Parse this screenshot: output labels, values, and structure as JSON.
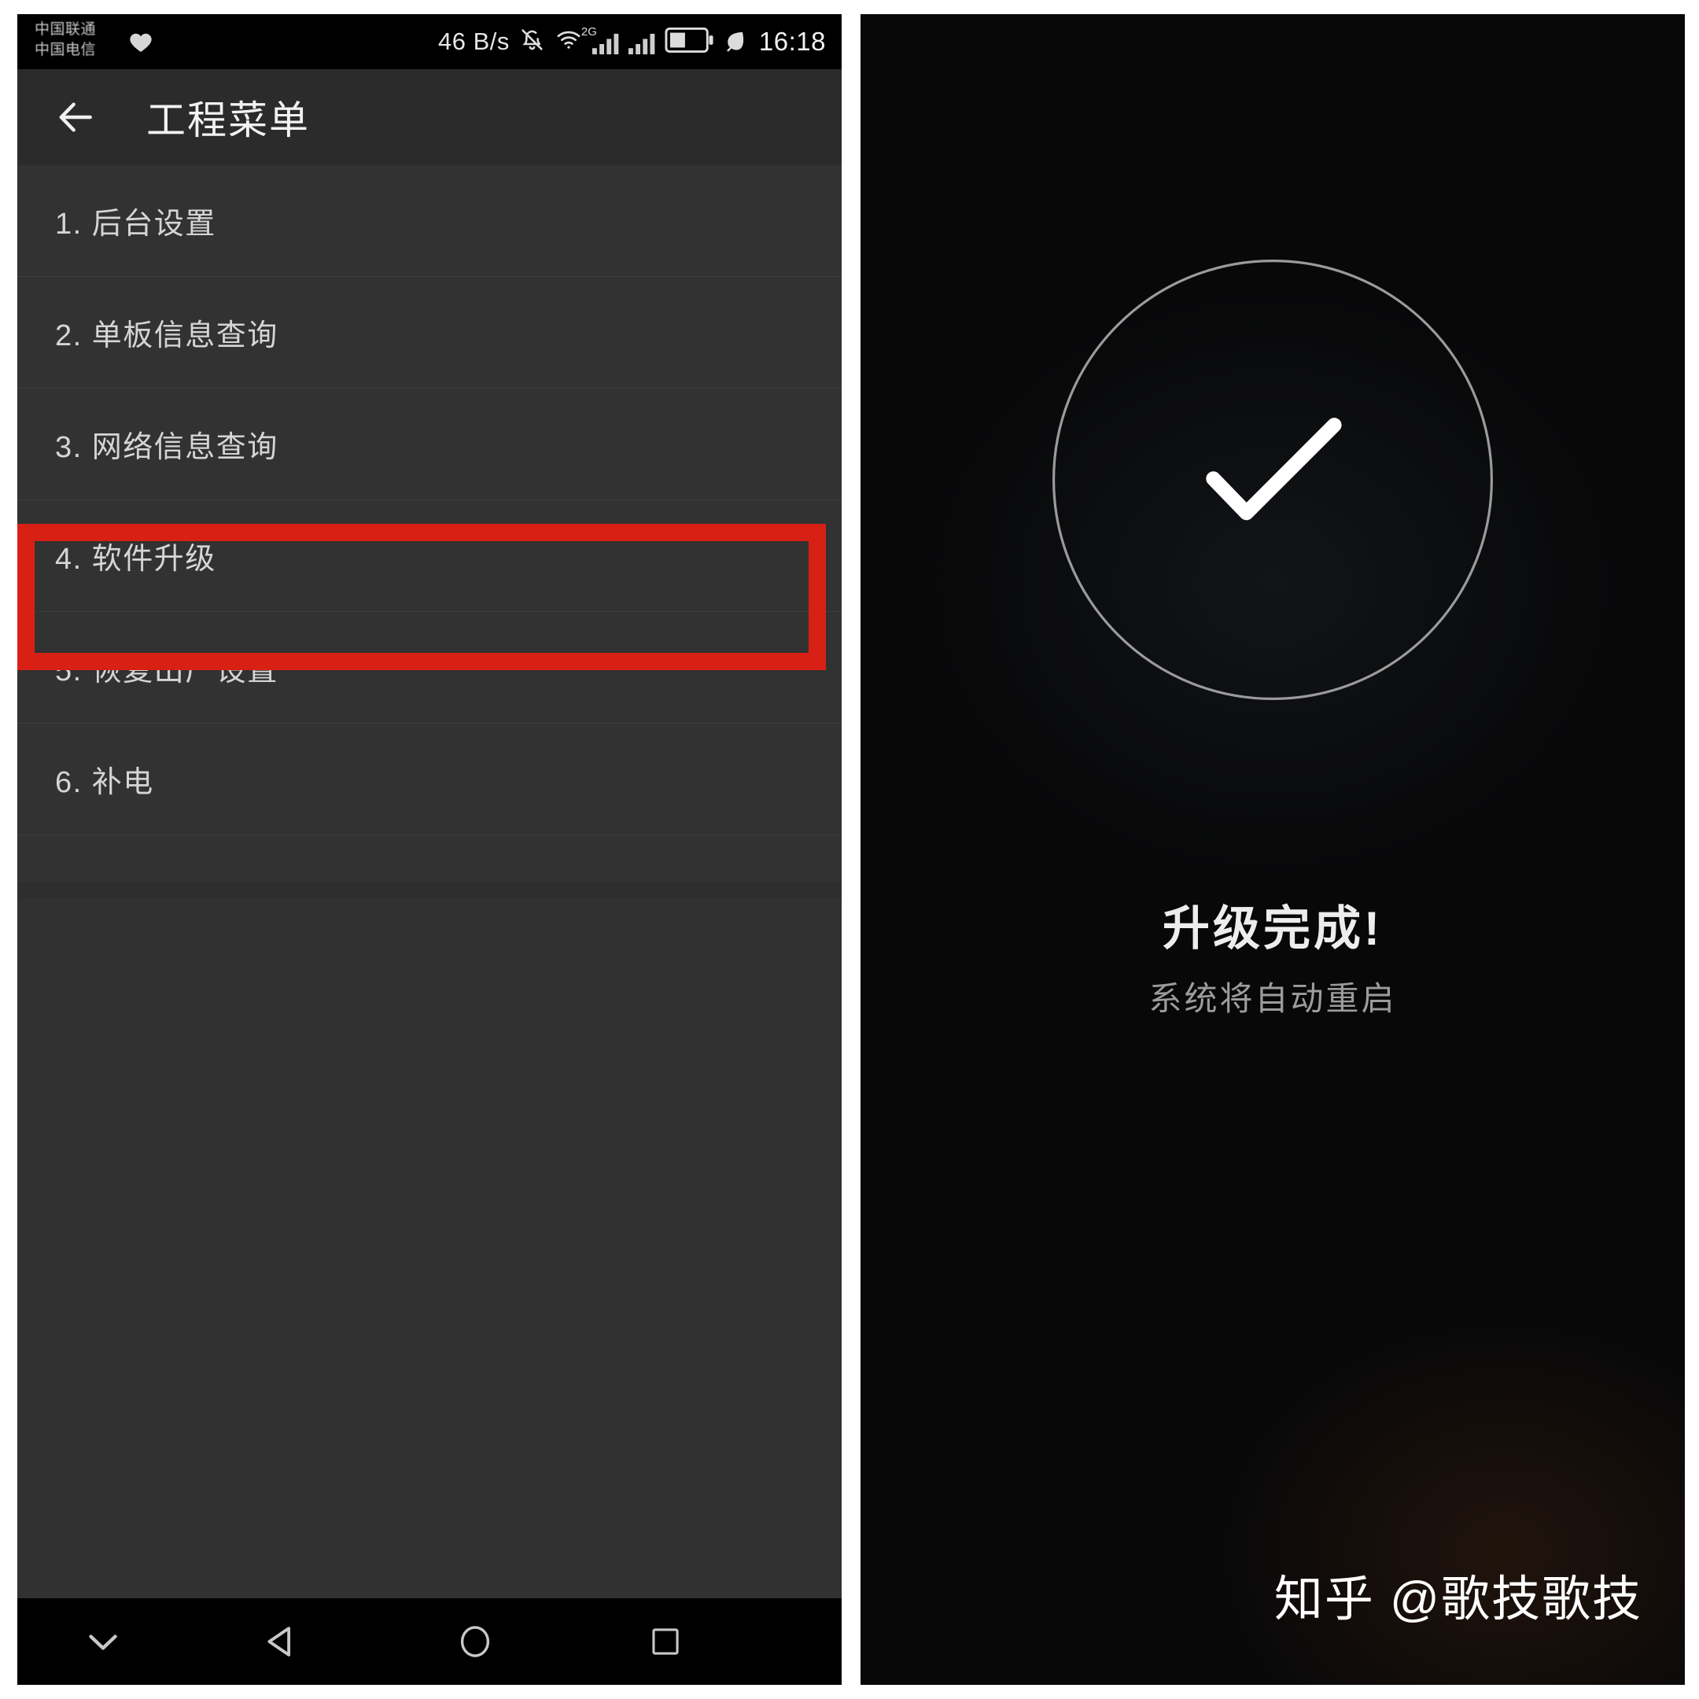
{
  "left_phone": {
    "status_bar": {
      "carrier_line1": "中国联通",
      "carrier_line2": "中国电信",
      "heart_icon": "heart-icon",
      "net_speed": "46 B/s",
      "mute_icon": "mute-bell-icon",
      "wifi_icon": "wifi-icon",
      "signal1_icon": "signal-bars-icon",
      "network_type_badge": "2G",
      "signal2_icon": "signal-bars-icon",
      "battery_icon": "battery-icon",
      "power_saver_icon": "leaf-icon",
      "clock": "16:18"
    },
    "app_bar": {
      "back_icon": "back-arrow-icon",
      "title": "工程菜单"
    },
    "menu_items": [
      {
        "label": "1. 后台设置"
      },
      {
        "label": "2. 单板信息查询"
      },
      {
        "label": "3. 网络信息查询"
      },
      {
        "label": "4. 软件升级"
      },
      {
        "label": "5. 恢复出厂设置"
      },
      {
        "label": "6. 补电"
      }
    ],
    "highlight": {
      "target_index": 3,
      "color": "#d92015"
    },
    "nav_bar": {
      "chevron_icon": "chevron-down-icon",
      "back_icon": "triangle-back-icon",
      "home_icon": "circle-home-icon",
      "recents_icon": "square-recents-icon"
    }
  },
  "right_phone": {
    "status_icon": "check-circle-icon",
    "title": "升级完成!",
    "subtitle": "系统将自动重启",
    "watermark": "知乎 @歌技歌技"
  }
}
